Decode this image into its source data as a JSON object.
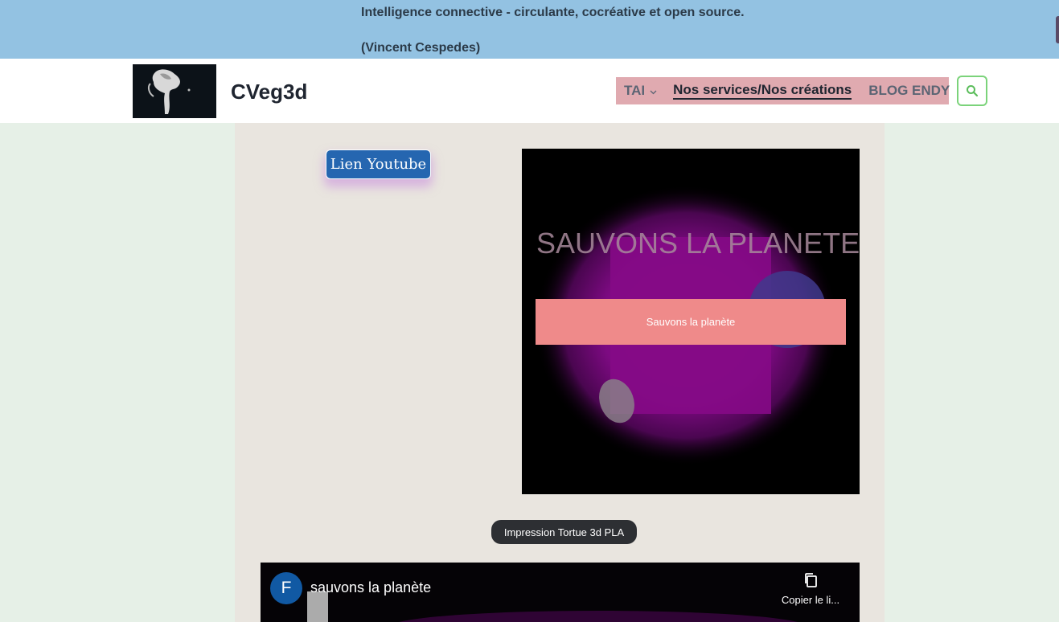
{
  "banner": {
    "line1": "Intelligence connective - circulante, cocréative et open source.",
    "line2": "(Vincent Cespedes)"
  },
  "header": {
    "site_title": "CVeg3d",
    "logo_icon": "sculpture-photo-logo",
    "nav": [
      {
        "label": "TAI",
        "has_dropdown": true
      },
      {
        "label": "Nos services/Nos créations",
        "active": true
      },
      {
        "label": "BLOG ENDY"
      }
    ],
    "search_icon": "search-icon"
  },
  "content": {
    "youtube_button_label": "Lien Youtube",
    "video_card": {
      "background_text": "SAUVONS LA PLANETE",
      "overlay_button_label": "Sauvons la planète"
    },
    "print_tag_label": "Impression Tortue 3d PLA",
    "embed": {
      "channel_initial": "F",
      "title": "sauvons la planète",
      "copy_label": "Copier le li...",
      "copy_icon": "copy-icon"
    }
  },
  "colors": {
    "banner_bg": "#93c2e2",
    "nav_bg": "#e0aab0",
    "search_border": "#7bd37a",
    "youtube_button": "#2566b0",
    "overlay_button": "#ef8a8a",
    "page_bg": "#e6f0e7",
    "panel_bg": "#e9e5df"
  }
}
